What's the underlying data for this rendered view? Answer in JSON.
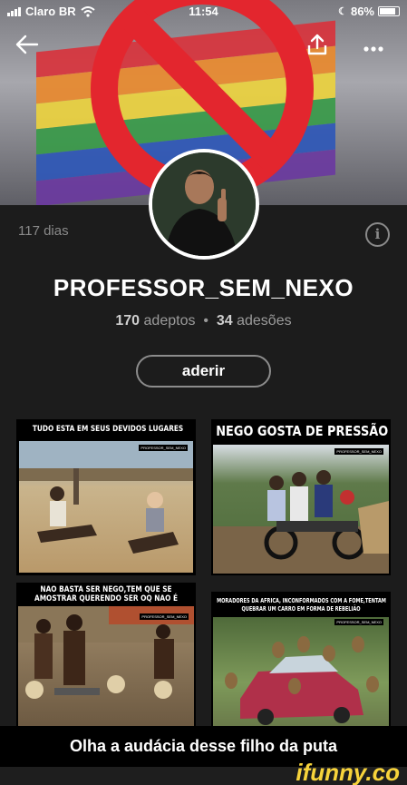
{
  "status_bar": {
    "carrier": "Claro BR",
    "time": "11:54",
    "battery": "86%",
    "battery_level": 0.86
  },
  "header": {
    "back_icon": "arrow-left-icon",
    "share_icon": "share-icon",
    "more_icon": "more-dots-icon"
  },
  "profile": {
    "days": "117 dias",
    "username": "PROFESSOR_SEM_NEXO",
    "followers_count": "170",
    "followers_label": "adeptos",
    "separator": "•",
    "following_count": "34",
    "following_label": "adesões",
    "join_label": "aderir"
  },
  "memes": [
    {
      "caption": "TUDO ESTA EM SEUS DEVIDOS LUGARES",
      "watermark": "PROFESSOR_SEM_NEXO"
    },
    {
      "caption": "NEGO GOSTA DE PRESSÃO",
      "watermark": "PROFESSOR_SEM_NEXO"
    },
    {
      "caption_line1": "NAO BASTA SER NEGO,TEM QUE SE",
      "caption_line2": "AMOSTRAR QUERENDO SER OQ NAO É",
      "watermark": "PROFESSOR_SEM_NEXO"
    },
    {
      "caption_line1": "MORADORES DA AFRICA, INCONFORMADOS COM A FOME,TENTAM",
      "caption_line2": "QUEBRAR UM CARRO EM FORMA DE REBELIÃO",
      "watermark": "PROFESSOR_SEM_NEXO"
    }
  ],
  "post_caption": "Olha a audácia desse filho da puta",
  "brand": "ifunny.co",
  "colors": {
    "background": "#1c1c1c",
    "ban_red": "#e3262e",
    "brand_yellow": "#f7d33b"
  }
}
